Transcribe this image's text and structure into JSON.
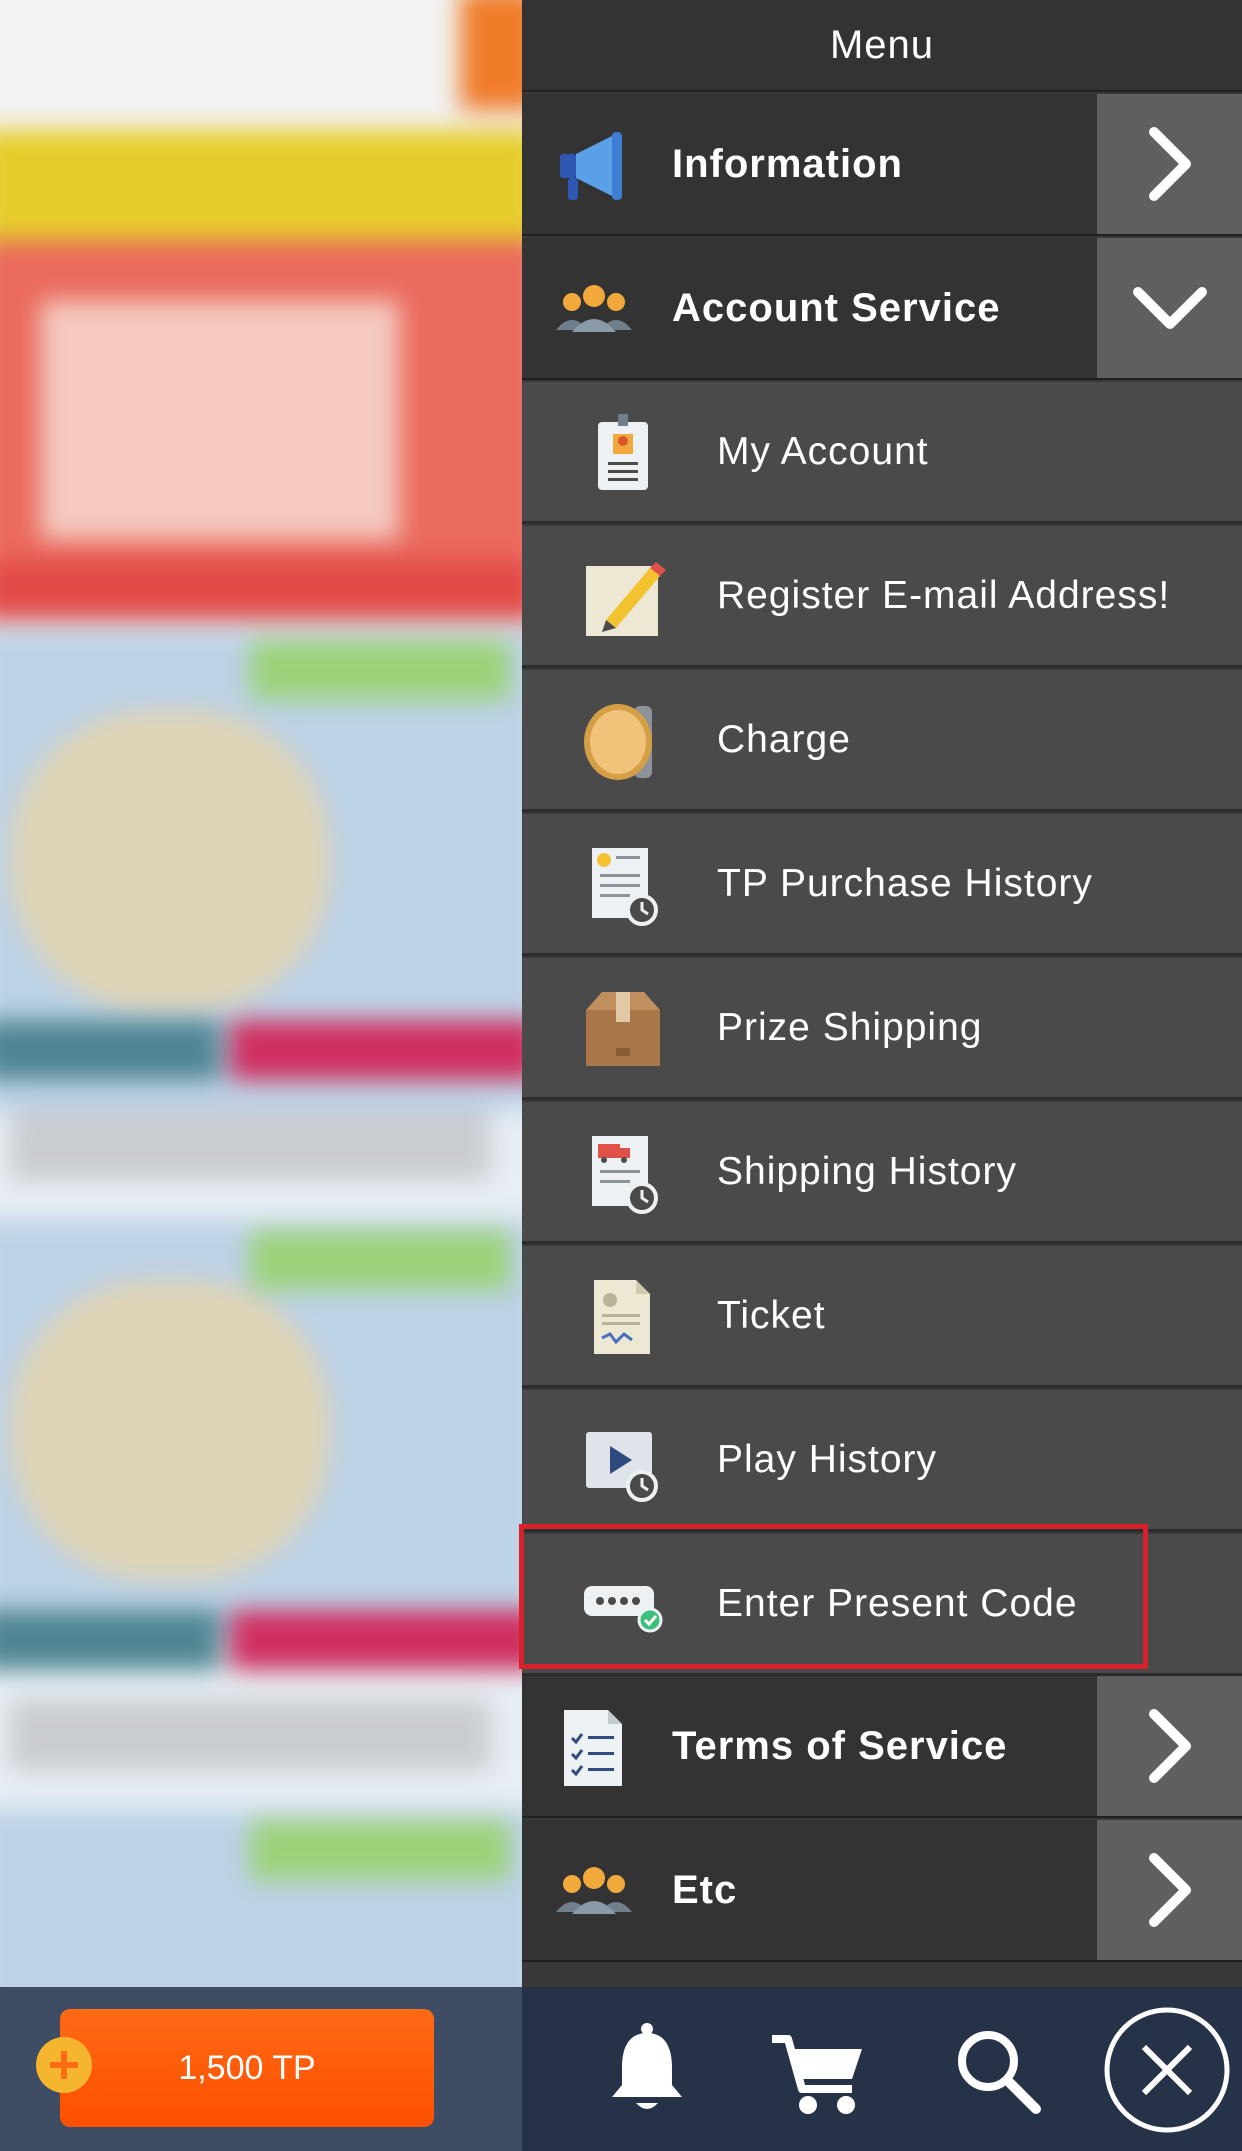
{
  "menu": {
    "title": "Menu",
    "information": "Information",
    "account_service": "Account Service",
    "items": [
      {
        "label": "My Account",
        "icon": "id-badge-icon"
      },
      {
        "label": "Register E-mail Address!",
        "icon": "pencil-note-icon"
      },
      {
        "label": "Charge",
        "icon": "coin-icon"
      },
      {
        "label": "TP Purchase History",
        "icon": "receipt-history-icon"
      },
      {
        "label": "Prize Shipping",
        "icon": "box-icon"
      },
      {
        "label": "Shipping History",
        "icon": "truck-history-icon"
      },
      {
        "label": "Ticket",
        "icon": "ticket-document-icon"
      },
      {
        "label": "Play History",
        "icon": "play-history-icon"
      },
      {
        "label": "Enter Present Code",
        "icon": "code-entry-icon"
      }
    ],
    "terms": "Terms of Service",
    "etc": "Etc"
  },
  "footer": {
    "tp_balance": "1,500 TP"
  },
  "colors": {
    "panel": "#393939",
    "item_bg": "#4a4a4a",
    "section_bg": "#333333",
    "highlight": "#d9212b",
    "tp_orange": "#ff5a0a"
  }
}
